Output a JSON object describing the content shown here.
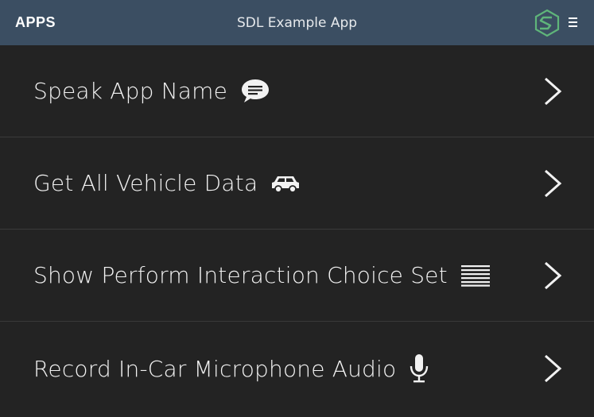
{
  "header": {
    "apps_label": "APPS",
    "title": "SDL Example App",
    "logo_icon": "sdl-logo-icon",
    "menu_icon": "hamburger-menu-icon",
    "background_color": "#3b4e62",
    "logo_color": "#5fb57a"
  },
  "menu": {
    "items": [
      {
        "label": "Speak App Name",
        "icon": "speech-bubble-icon"
      },
      {
        "label": "Get All Vehicle Data",
        "icon": "car-icon"
      },
      {
        "label": "Show Perform Interaction Choice Set",
        "icon": "list-lines-icon"
      },
      {
        "label": "Record In-Car Microphone Audio",
        "icon": "microphone-icon"
      }
    ],
    "chevron_icon": "chevron-right-icon",
    "background_color": "#232323"
  }
}
